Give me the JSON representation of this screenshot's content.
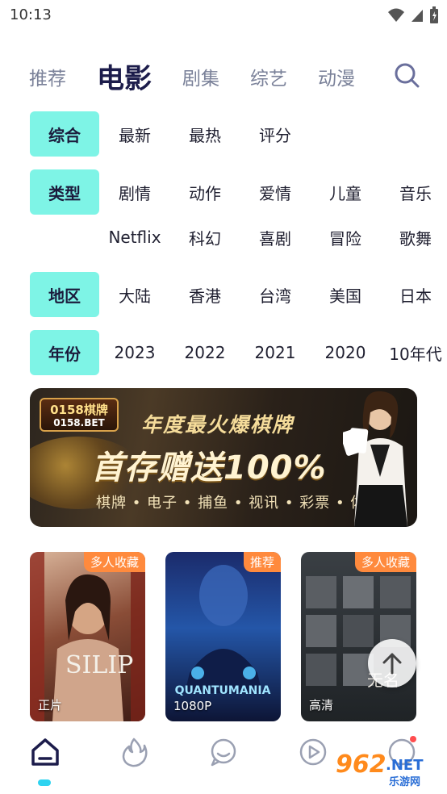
{
  "status_bar": {
    "time": "10:13"
  },
  "top_tabs": [
    {
      "label": "推荐",
      "active": false
    },
    {
      "label": "电影",
      "active": true
    },
    {
      "label": "剧集",
      "active": false
    },
    {
      "label": "综艺",
      "active": false
    },
    {
      "label": "动漫",
      "active": false
    }
  ],
  "filters": {
    "sort": {
      "label": "综合",
      "options": [
        "最新",
        "最热",
        "评分"
      ]
    },
    "genre": {
      "label": "类型",
      "options_row1": [
        "剧情",
        "动作",
        "爱情",
        "儿童",
        "音乐"
      ],
      "options_row2": [
        "Netflix",
        "科幻",
        "喜剧",
        "冒险",
        "歌舞"
      ]
    },
    "region": {
      "label": "地区",
      "options": [
        "大陆",
        "香港",
        "台湾",
        "美国",
        "日本"
      ]
    },
    "year": {
      "label": "年份",
      "options": [
        "2023",
        "2022",
        "2021",
        "2020",
        "10年代"
      ]
    }
  },
  "banner": {
    "logo_text": "0158棋牌",
    "logo_sub": "0158.BET",
    "line1": "年度最火爆棋牌",
    "line2": "首存赠送100%",
    "line3": "棋牌 • 电子 • 捕鱼 • 视讯 • 彩票 • 体育"
  },
  "cards": [
    {
      "badge": "多人收藏",
      "caption": "正片",
      "poster_title": "SILIP"
    },
    {
      "badge": "推荐",
      "caption": "1080P",
      "poster_title": "QUANTUMANIA"
    },
    {
      "badge": "多人收藏",
      "caption": "高清",
      "poster_title": "无名"
    }
  ],
  "bottom_nav": [
    {
      "icon": "home-icon",
      "active": true
    },
    {
      "icon": "fire-icon",
      "active": false
    },
    {
      "icon": "chat-icon",
      "active": false
    },
    {
      "icon": "play-icon",
      "active": false
    },
    {
      "icon": "profile-icon",
      "active": false
    }
  ],
  "watermark": {
    "logo": "962",
    "net": ".NET",
    "sub": "乐游网"
  },
  "colors": {
    "accent": "#7ef4e6",
    "active_text": "#1c1c4b",
    "inactive_text": "#7a8199",
    "badge": "#ff8a3d",
    "indicator": "#2ed3f0"
  }
}
